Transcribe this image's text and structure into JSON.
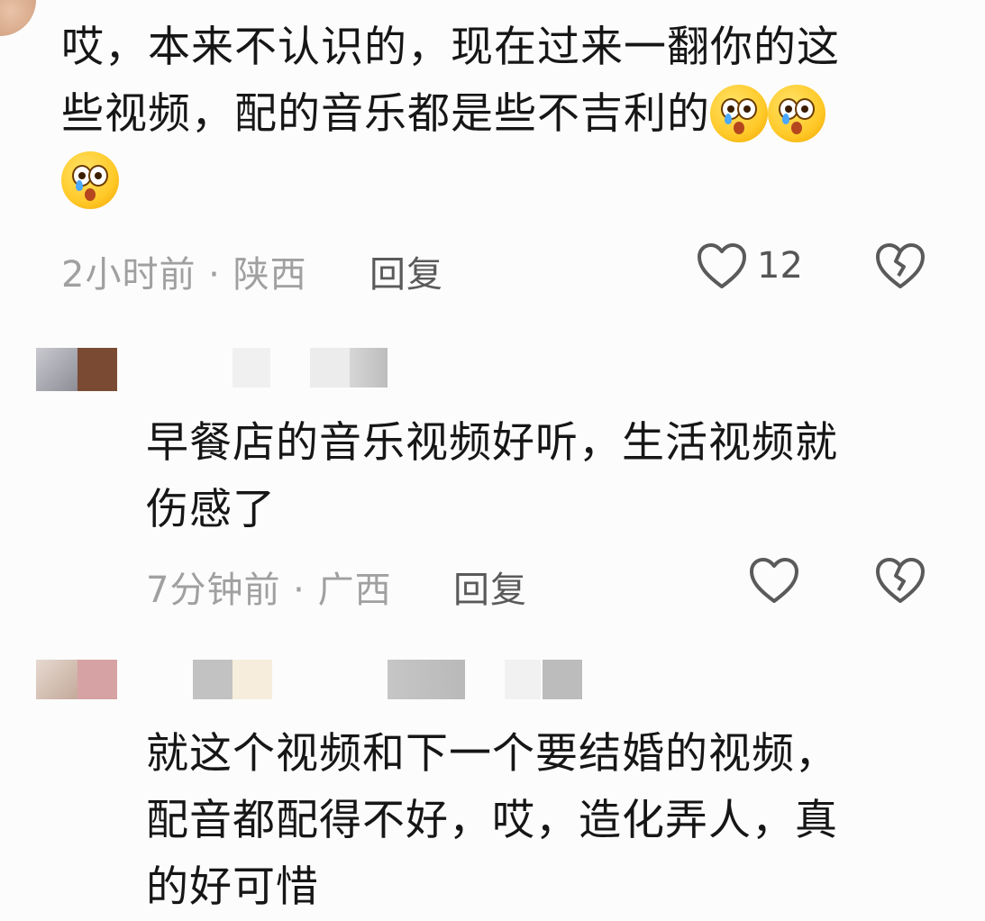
{
  "comments": [
    {
      "text": "哎，本来不认识的，现在过来一翻你的这些视频，配的音乐都是些不吉利的",
      "line1": "哎，本来不认识的，现在过来一翻你的这",
      "line2": "些视频，配的音乐都是些不吉利的",
      "emoji": "cold-sweat-tear-emoji",
      "time": "2小时前",
      "location": "陕西",
      "reply_label": "回复",
      "like_count": "12"
    },
    {
      "line1": "早餐店的音乐视频好听，生活视频就",
      "line2": "伤感了",
      "time": "7分钟前",
      "location": "广西",
      "reply_label": "回复"
    },
    {
      "line1": "就这个视频和下一个要结婚的视频，",
      "line2": "配音都配得不好，哎，造化弄人，真",
      "line3": "的好可惜"
    }
  ],
  "separator": " · ",
  "colors": {
    "text": "#161616",
    "meta": "#a0a0a0",
    "icon": "#5a5a5a"
  }
}
